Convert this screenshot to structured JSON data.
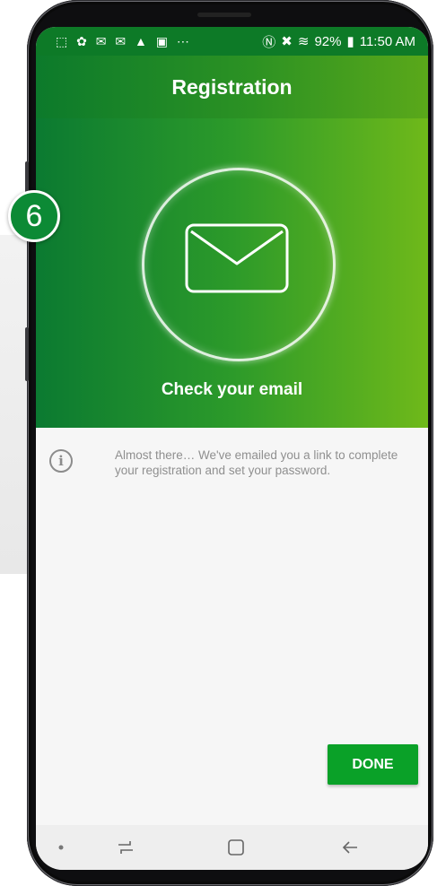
{
  "step_badge": "6",
  "status_bar": {
    "notification_icons": "⬚ ✿ ✉ ✉ ▲ ▣  ⋯",
    "battery_percent": "92%",
    "time": "11:50 AM"
  },
  "app_bar": {
    "title": "Registration"
  },
  "hero": {
    "caption": "Check your email"
  },
  "info": {
    "message": "Almost there… We've emailed you a link to complete your registration and set your password."
  },
  "actions": {
    "done_label": "DONE"
  },
  "colors": {
    "brand_green": "#0aa128",
    "gradient_start": "#0b7a31",
    "gradient_end": "#6fb91a"
  }
}
